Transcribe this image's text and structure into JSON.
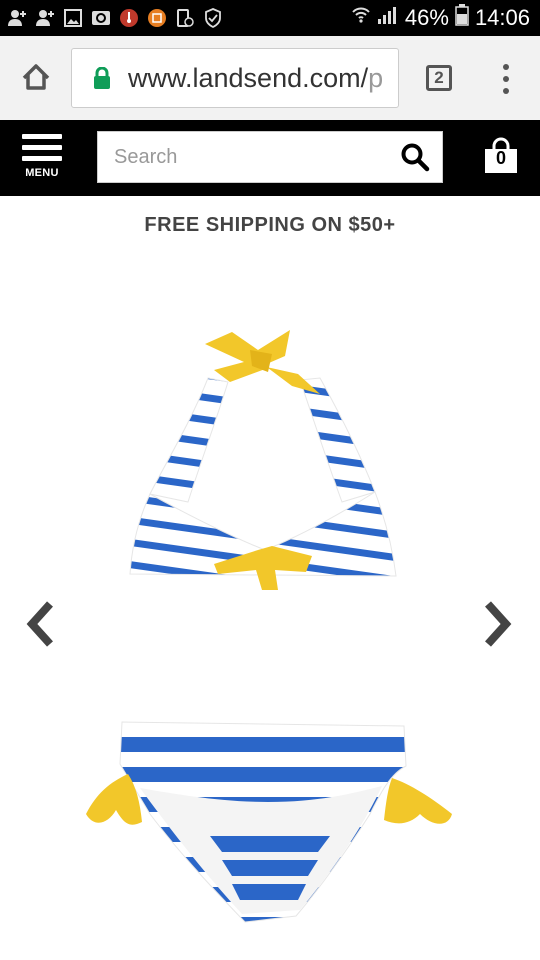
{
  "status_bar": {
    "battery": "46%",
    "time": "14:06"
  },
  "browser": {
    "url_main": "www.landsend.com/",
    "url_rest": "p",
    "tab_count": "2"
  },
  "site_header": {
    "menu_label": "MENU",
    "search_placeholder": "Search",
    "cart_count": "0"
  },
  "promo": {
    "text": "FREE SHIPPING ON $50+"
  },
  "product": {
    "stripe_color": "#2b66c8",
    "tie_color": "#f2c72a"
  },
  "colors": {
    "header_bg": "#000000",
    "browser_bg": "#f2f2f2",
    "lock_green": "#0f9d58"
  }
}
